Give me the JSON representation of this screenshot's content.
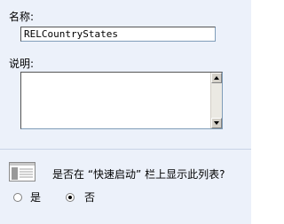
{
  "form": {
    "name_label": "名称:",
    "name_value": "RELCountryStates",
    "description_label": "说明:",
    "description_value": ""
  },
  "quick_launch": {
    "icon": "list-table-icon",
    "question": "是否在 “快速启动” 栏上显示此列表?",
    "options": [
      {
        "label": "是",
        "selected": false
      },
      {
        "label": "否",
        "selected": true
      }
    ]
  },
  "colors": {
    "panel_background": "#ecf1fa",
    "input_border": "#7f9db9"
  }
}
